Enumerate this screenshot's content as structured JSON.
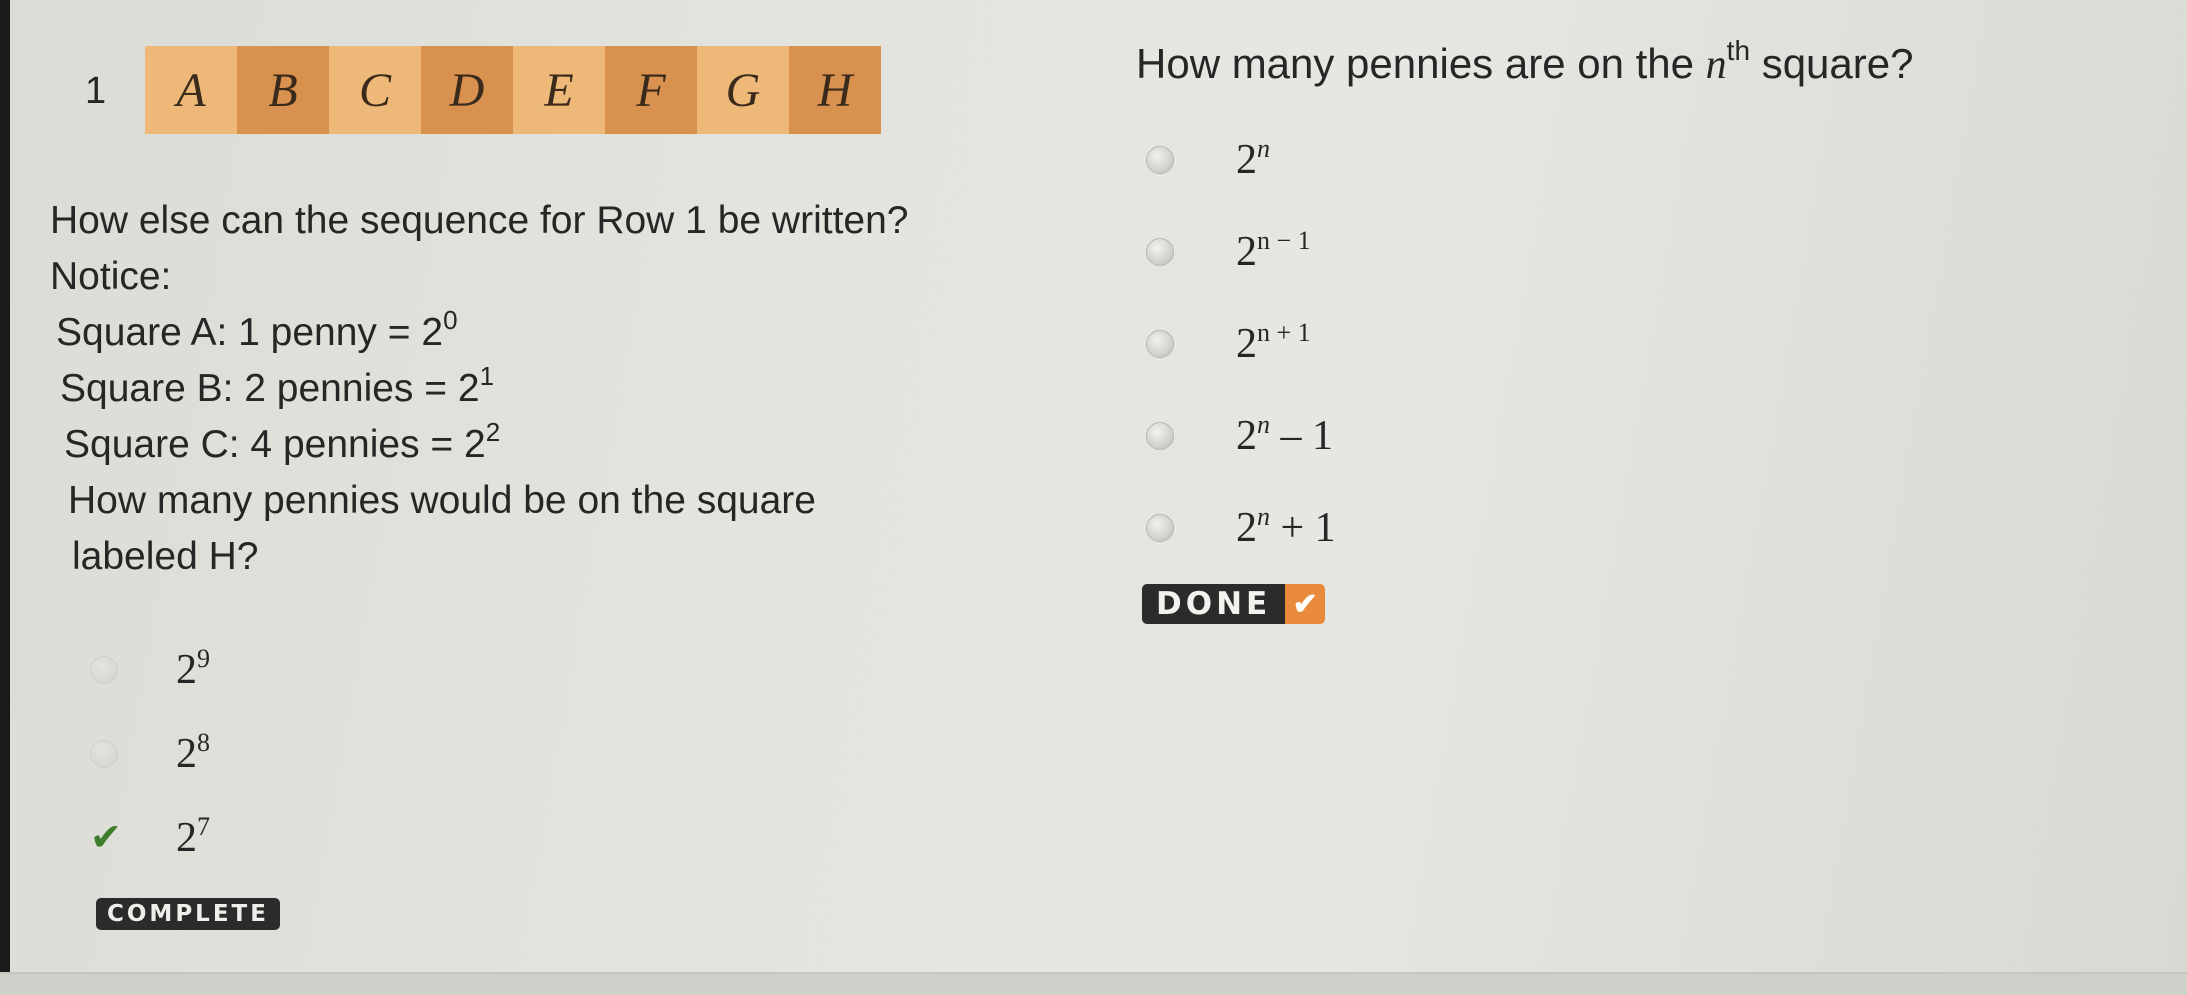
{
  "row": {
    "number": "1",
    "squares": [
      "A",
      "B",
      "C",
      "D",
      "E",
      "F",
      "G",
      "H"
    ]
  },
  "question1": {
    "prompt": "How else can the sequence for Row 1 be written?",
    "notice": "Notice:",
    "lines": [
      {
        "text": "Square A: 1 penny = 2",
        "exp": "0"
      },
      {
        "text": "Square B: 2 pennies = 2",
        "exp": "1"
      },
      {
        "text": "Square C: 4 pennies = 2",
        "exp": "2"
      }
    ],
    "ask_line1": "How many pennies would be on the square",
    "ask_line2": "labeled H?",
    "choices": [
      {
        "base": "2",
        "exp": "9",
        "state": "unselected"
      },
      {
        "base": "2",
        "exp": "8",
        "state": "unselected"
      },
      {
        "base": "2",
        "exp": "7",
        "state": "correct"
      }
    ],
    "status": "COMPLETE"
  },
  "question2": {
    "prompt_before": "How many pennies are on the ",
    "prompt_var": "n",
    "prompt_sup": "th",
    "prompt_after": " square?",
    "choices": [
      {
        "base": "2",
        "exp": "n",
        "tail": ""
      },
      {
        "base": "2",
        "exp": "n − 1",
        "tail": ""
      },
      {
        "base": "2",
        "exp": "n + 1",
        "tail": ""
      },
      {
        "base": "2",
        "exp": "n",
        "tail": " – 1"
      },
      {
        "base": "2",
        "exp": "n",
        "tail": " + 1"
      }
    ],
    "done_label": "DONE",
    "done_icon": "✔"
  },
  "colors": {
    "square_light": "#eeb878",
    "square_dark": "#d8914e",
    "done_accent": "#e98a3c",
    "check_green": "#3e7d2c"
  }
}
